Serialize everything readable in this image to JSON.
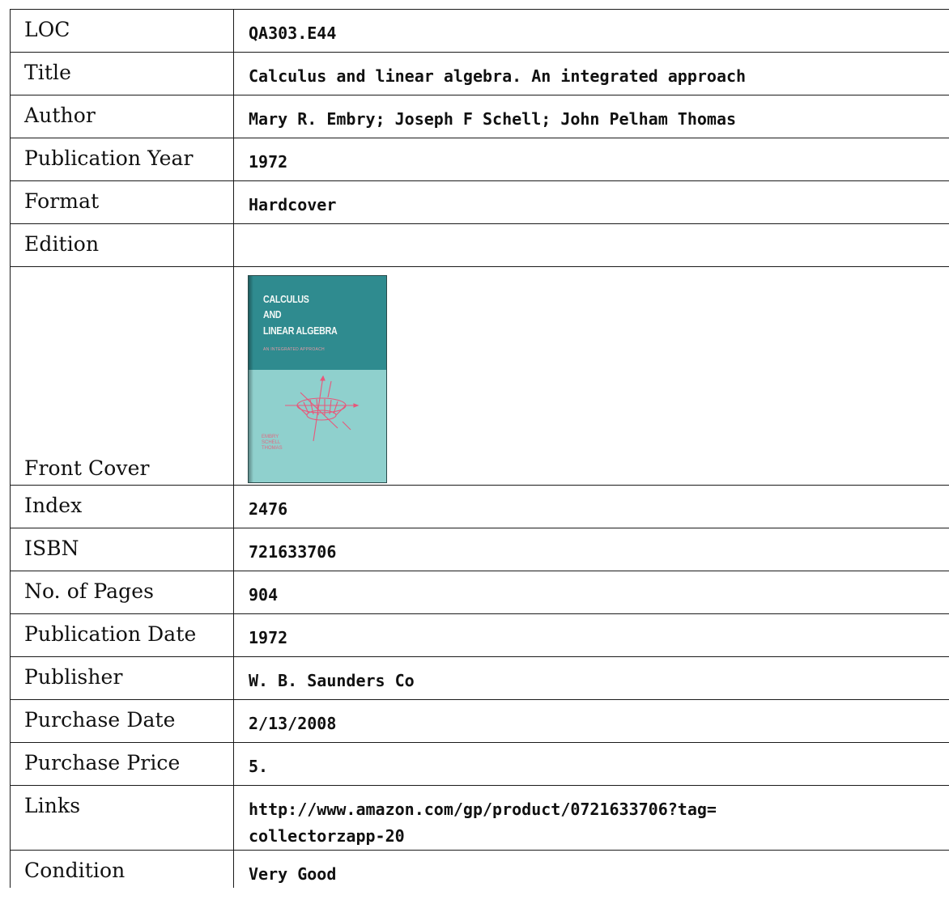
{
  "rows": {
    "loc": {
      "label": "LOC",
      "value": "QA303.E44"
    },
    "title": {
      "label": "Title",
      "value": "Calculus and linear algebra. An integrated approach"
    },
    "author": {
      "label": "Author",
      "value": "Mary R. Embry; Joseph F Schell; John Pelham Thomas"
    },
    "publication_year": {
      "label": "Publication Year",
      "value": "1972"
    },
    "format": {
      "label": "Format",
      "value": "Hardcover"
    },
    "edition": {
      "label": "Edition",
      "value": ""
    },
    "front_cover": {
      "label": "Front Cover",
      "cover_text": {
        "line1": "CALCULUS",
        "line2": "AND",
        "line3": "LINEAR ALGEBRA",
        "subtitle": "AN INTEGRATED APPROACH",
        "author1": "EMBRY",
        "author2": "SCHELL",
        "author3": "THOMAS"
      },
      "colors": {
        "top_band": "#2f8b8f",
        "bottom": "#8fd0cd",
        "figure": "#e8577a"
      }
    },
    "index": {
      "label": "Index",
      "value": "2476"
    },
    "isbn": {
      "label": "ISBN",
      "value": "721633706"
    },
    "pages": {
      "label": "No. of Pages",
      "value": "904"
    },
    "publication_date": {
      "label": "Publication Date",
      "value": "1972"
    },
    "publisher": {
      "label": "Publisher",
      "value": "W. B. Saunders Co"
    },
    "purchase_date": {
      "label": "Purchase Date",
      "value": "2/13/2008"
    },
    "purchase_price": {
      "label": "Purchase Price",
      "value": "5."
    },
    "links": {
      "label": "Links",
      "value_line1": "http://www.amazon.com/gp/product/0721633706?tag=",
      "value_line2": "collectorzapp-20"
    },
    "condition": {
      "label": "Condition",
      "value": "Very Good"
    }
  }
}
